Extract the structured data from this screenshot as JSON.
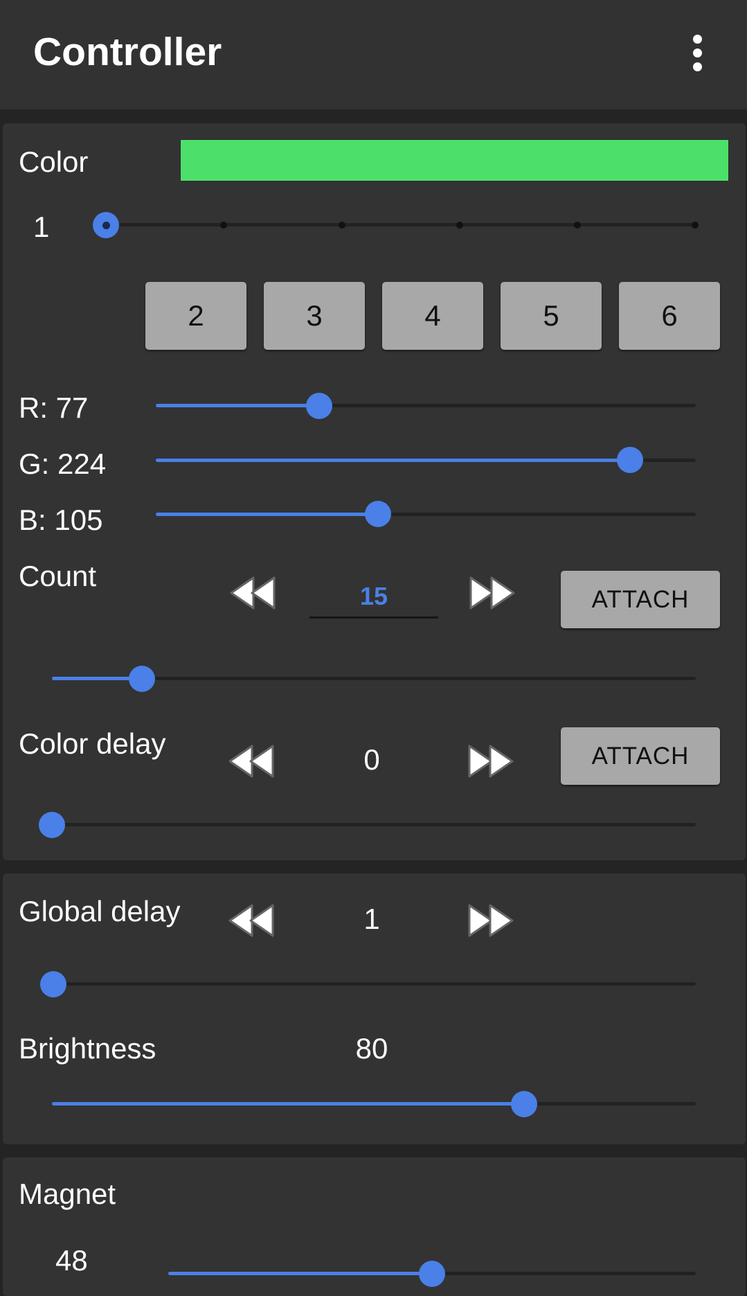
{
  "appbar": {
    "title": "Controller"
  },
  "color_section": {
    "label": "Color",
    "swatch_color": "#4ce06a",
    "stepper_value": "1",
    "step_count": 6,
    "current_step": 1,
    "buttons": [
      "2",
      "3",
      "4",
      "5",
      "6"
    ]
  },
  "rgb": {
    "r_label": "R: 77",
    "r_value": 77,
    "g_label": "G: 224",
    "g_value": 224,
    "b_label": "B: 105",
    "b_value": 105,
    "max": 255
  },
  "count": {
    "label": "Count",
    "value": "15",
    "attach_label": "ATTACH",
    "slider_fraction": 0.14
  },
  "color_delay": {
    "label": "Color delay",
    "value": "0",
    "attach_label": "ATTACH",
    "slider_fraction": 0.0
  },
  "global_delay": {
    "label": "Global delay",
    "value": "1",
    "slider_fraction": 0.0
  },
  "brightness": {
    "label": "Brightness",
    "value": "80",
    "slider_fraction": 0.733
  },
  "magnet": {
    "label": "Magnet",
    "value": "48"
  },
  "colors": {
    "accent": "#4a80e8",
    "background": "#242424",
    "card": "#333333",
    "button": "#a8a8a8"
  }
}
